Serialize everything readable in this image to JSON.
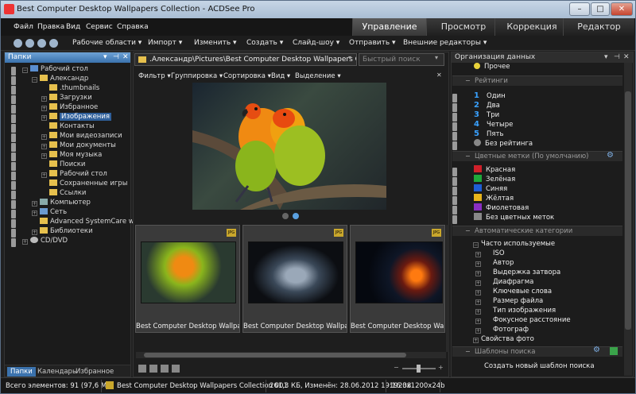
{
  "window": {
    "title": "Best Computer Desktop Wallpapers Collection - ACDSee Pro"
  },
  "menu": [
    "Файл",
    "Правка",
    "Вид",
    "Сервис",
    "Справка"
  ],
  "modes": [
    "Управление",
    "Просмотр",
    "Коррекция",
    "Редактор"
  ],
  "toolbar": [
    "Рабочие области ▾",
    "Импорт ▾",
    "Изменить ▾",
    "Создать ▾",
    "Слайд-шоу ▾",
    "Отправить ▾",
    "Внешние редакторы ▾"
  ],
  "folders": {
    "header": "Папки",
    "items": [
      "Рабочий стол",
      "Александр",
      ".thumbnails",
      "Загрузки",
      "Избранное",
      "Изображения",
      "Контакты",
      "Мои видеозаписи",
      "Мои документы",
      "Моя музыка",
      "Поиски",
      "Рабочий стол",
      "Сохраненные игры",
      "Ссылки",
      "Компьютер",
      "Сеть",
      "Advanced SystemCare with An",
      "Библиотеки",
      "CD/DVD"
    ],
    "tabs": [
      "Папки",
      "Календарь",
      "Избранное"
    ]
  },
  "address": {
    "path": ".Александр\\Pictures\\Best Computer Desktop Wallpapers Collection",
    "search_placeholder": "Быстрый поиск"
  },
  "filters": [
    "Фильтр ▾",
    "Группировка ▾",
    "Сортировка ▾",
    "Вид ▾",
    "Выделение ▾"
  ],
  "thumbs": {
    "badge": "JPG",
    "items": [
      "Best Computer Desktop Wallpaper...",
      "Best Computer Desktop Wallpaper...",
      "Best Computer Desktop Wallpaper..."
    ]
  },
  "org": {
    "header": "Организация данных",
    "other": "Прочее",
    "ratings_title": "Рейтинги",
    "ratings": [
      {
        "n": "1",
        "label": "Один"
      },
      {
        "n": "2",
        "label": "Два"
      },
      {
        "n": "3",
        "label": "Три"
      },
      {
        "n": "4",
        "label": "Четыре"
      },
      {
        "n": "5",
        "label": "Пять"
      }
    ],
    "no_rating": "Без рейтинга",
    "colors_title": "Цветные метки (По умолчанию)",
    "colors": [
      {
        "label": "Красная",
        "color": "#d0202a"
      },
      {
        "label": "Зелёная",
        "color": "#1fa83a"
      },
      {
        "label": "Синяя",
        "color": "#1e5ed6"
      },
      {
        "label": "Жёлтая",
        "color": "#e8b51c"
      },
      {
        "label": "Фиолетовая",
        "color": "#8a2ec2"
      }
    ],
    "no_colors": "Без цветных меток",
    "auto_title": "Автоматические категории",
    "auto_items": [
      "Часто используемые",
      "ISO",
      "Автор",
      "Выдержка затвора",
      "Диафрагма",
      "Ключевые слова",
      "Размер файла",
      "Тип изображения",
      "Фокусное расстояние",
      "Фотограф",
      "Свойства фото"
    ],
    "search_title": "Шаблоны поиска",
    "search_new": "Создать новый шаблон поиска"
  },
  "status": {
    "count": "Всего элементов: 91  (97,6 МБ)",
    "file": "Best Computer Desktop Wallpapers Collection 001",
    "info": "261,3 КБ, Изменён: 28.06.2012 19:16:38",
    "dims": "1920x1200x24b"
  },
  "colors": {
    "accent": "#3b72ad",
    "selection": "#2f5f9a",
    "rating_blue": "#39a1ff"
  }
}
